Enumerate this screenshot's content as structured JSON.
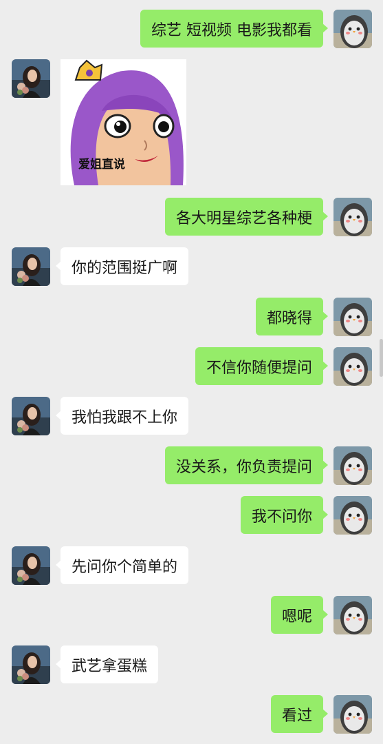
{
  "messages": [
    {
      "from": "me",
      "text": "综艺 短视频 电影我都看"
    },
    {
      "from": "other",
      "type": "sticker",
      "caption": "爱姐直说"
    },
    {
      "from": "me",
      "text": "各大明星综艺各种梗"
    },
    {
      "from": "other",
      "text": "你的范围挺广啊"
    },
    {
      "from": "me",
      "text": "都晓得"
    },
    {
      "from": "me",
      "text": "不信你随便提问"
    },
    {
      "from": "other",
      "text": "我怕我跟不上你"
    },
    {
      "from": "me",
      "text": "没关系，你负责提问"
    },
    {
      "from": "me",
      "text": "我不问你"
    },
    {
      "from": "other",
      "text": "先问你个简单的"
    },
    {
      "from": "me",
      "text": "嗯呢"
    },
    {
      "from": "other",
      "text": "武艺拿蛋糕"
    },
    {
      "from": "me",
      "text": "看过"
    }
  ],
  "colors": {
    "my_bubble": "#95ec69",
    "other_bubble": "#ffffff",
    "background": "#ededed"
  }
}
